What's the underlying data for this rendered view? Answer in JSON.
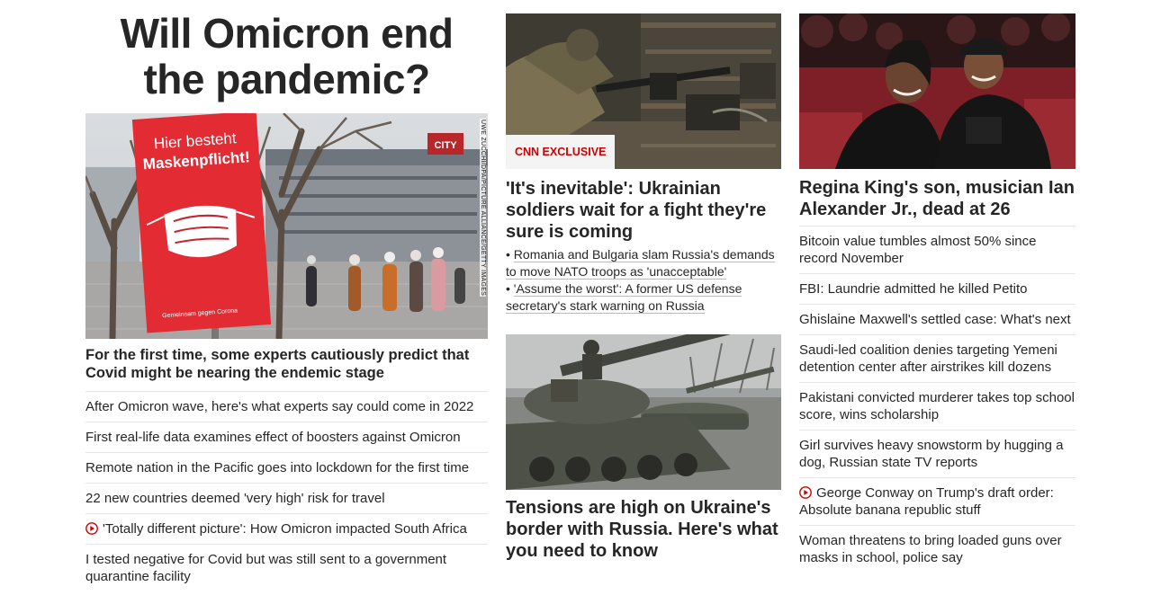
{
  "left": {
    "headline": "Will Omicron end the pandemic?",
    "photo_credit": "UWE ZUCCHI/DPA/PICTURE ALLIANCE/GETTY IMAGES",
    "sign_text_1": "Hier besteht",
    "sign_text_2": "Maskenpflicht!",
    "sign_footer": "Gemeinsam gegen Corona",
    "store_sign": "CITY",
    "lead_sub": "For the first time, some experts cautiously predict that Covid might be nearing the endemic stage",
    "links": [
      "After Omicron wave, here's what experts say could come in 2022",
      "First real-life data examines effect of boosters against Omicron",
      "Remote nation in the Pacific goes into lockdown for the first time",
      "22 new countries deemed 'very high' risk for travel",
      "'Totally different picture': How Omicron impacted South Africa",
      "I tested negative for Covid but was still sent to a government quarantine facility"
    ]
  },
  "center": {
    "badge": "CNN EXCLUSIVE",
    "story1_headline": "'It's inevitable': Ukrainian soldiers wait for a fight they're sure is coming",
    "bullets": [
      "Romania and Bulgaria slam Russia's demands to move NATO troops as 'unacceptable'",
      "'Assume the worst': A former US defense secretary's stark warning on Russia"
    ],
    "story2_headline": "Tensions are high on Ukraine's border with Russia. Here's what you need to know"
  },
  "right": {
    "headline": "Regina King's son, musician Ian Alexander Jr., dead at 26",
    "links": [
      "Bitcoin value tumbles almost 50% since record November",
      "FBI: Laundrie admitted he killed Petito",
      "Ghislaine Maxwell's settled case: What's next",
      "Saudi-led coalition denies targeting Yemeni detention center after airstrikes kill dozens",
      "Pakistani convicted murderer takes top school score, wins scholarship",
      "Girl survives heavy snowstorm by hugging a dog, Russian state TV reports",
      "George Conway on Trump's draft order: Absolute banana republic stuff",
      "Woman threatens to bring loaded guns over masks in school, police say"
    ]
  },
  "colors": {
    "accent": "#cc0000",
    "text": "#262626",
    "rule": "#e6e6e6"
  },
  "icons": {
    "video": "play-circle-icon"
  }
}
